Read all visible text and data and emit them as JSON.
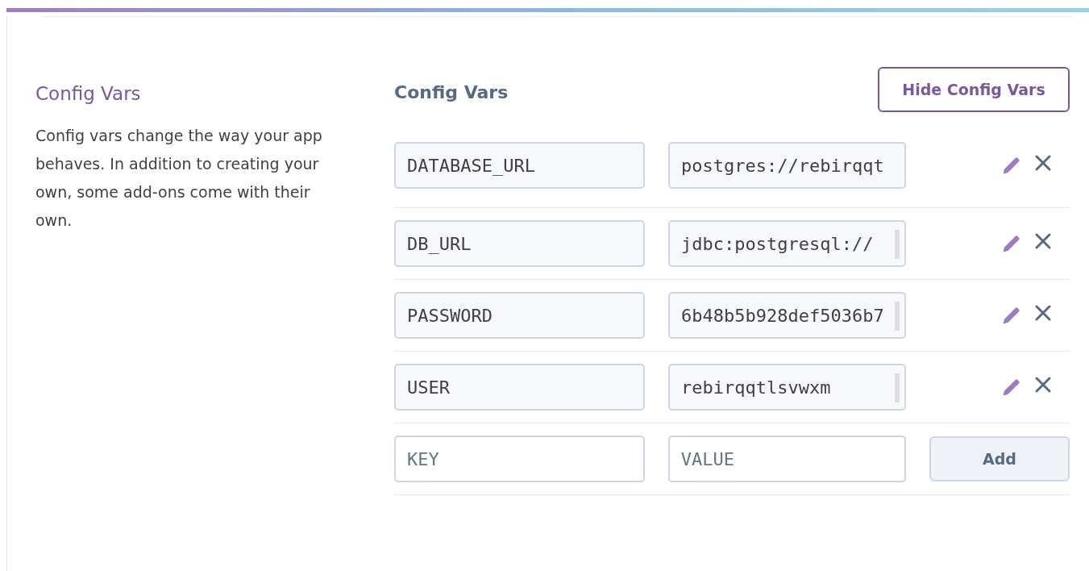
{
  "section": {
    "title": "Config Vars",
    "description": "Config vars change the way your app behaves. In addition to creating your own, some add-ons come with their own."
  },
  "panel": {
    "title": "Config Vars",
    "toggle_button": "Hide Config Vars"
  },
  "vars": [
    {
      "key": "DATABASE_URL",
      "value": "postgres://rebirqqt",
      "scrollbar": false
    },
    {
      "key": "DB_URL",
      "value": "jdbc:postgresql://",
      "scrollbar": true
    },
    {
      "key": "PASSWORD",
      "value": "6b48b5b928def5036b7",
      "scrollbar": true
    },
    {
      "key": "USER",
      "value": "rebirqqtlsvwxm",
      "scrollbar": true
    }
  ],
  "new_var": {
    "key_placeholder": "KEY",
    "value_placeholder": "VALUE",
    "add_button": "Add"
  }
}
